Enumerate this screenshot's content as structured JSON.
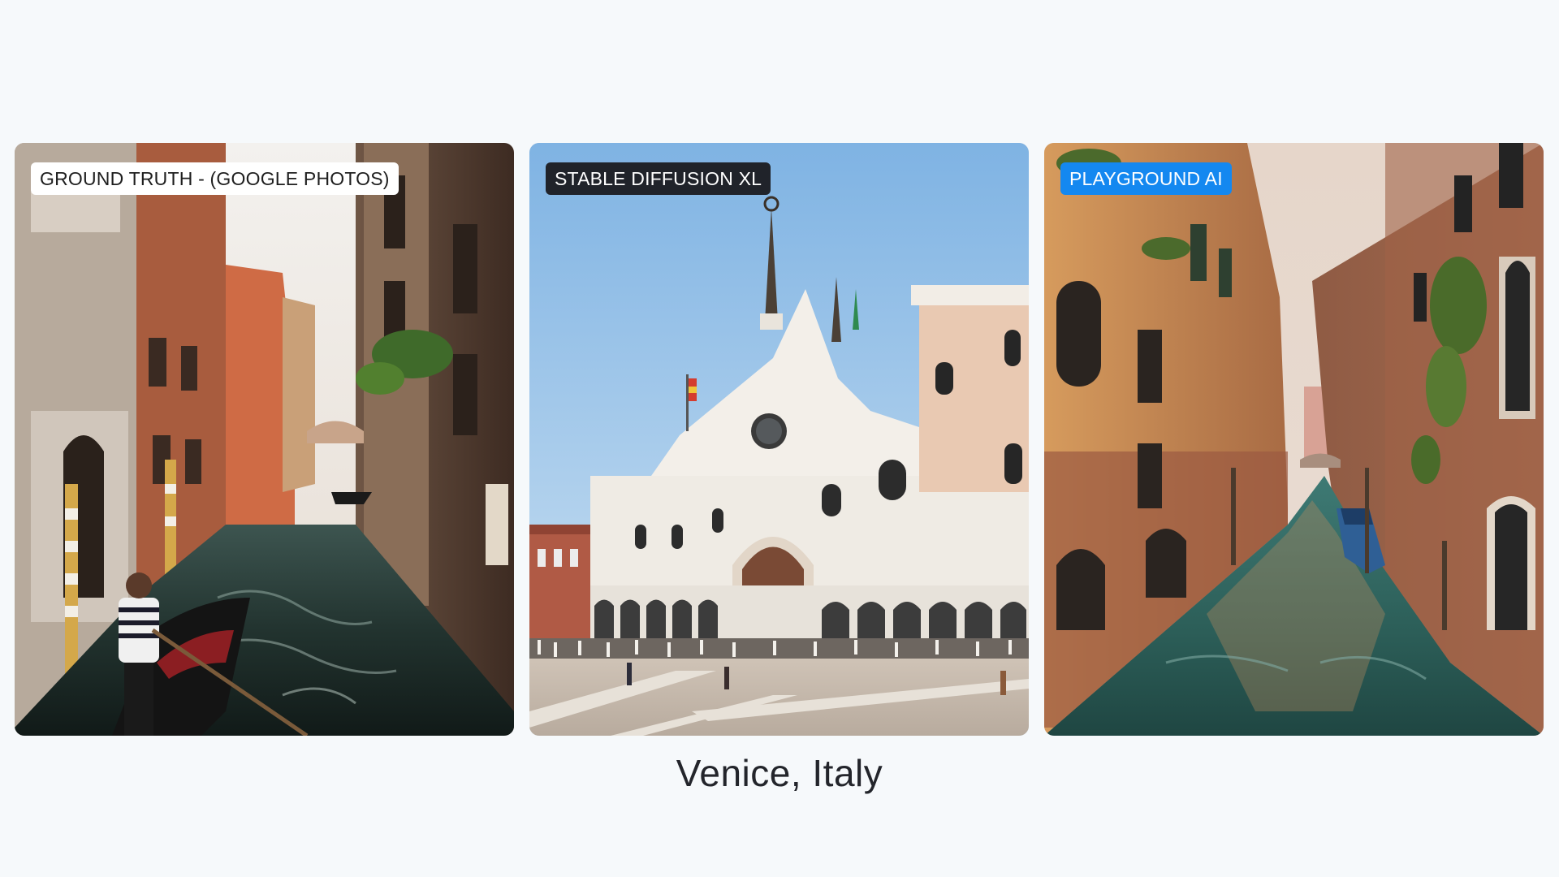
{
  "cards": [
    {
      "label": "GROUND TRUTH - (GOOGLE PHOTOS)",
      "label_style": "light",
      "scene": "venice-canal-gondola-photo"
    },
    {
      "label": "STABLE DIFFUSION XL",
      "label_style": "dark",
      "scene": "piazza-san-marco-render"
    },
    {
      "label": "PLAYGROUND AI",
      "label_style": "blue",
      "scene": "venice-canal-reflection-render"
    }
  ],
  "caption": "Venice, Italy",
  "colors": {
    "background": "#f6f9fb",
    "label_light": "#ffffff",
    "label_dark": "#20232a",
    "label_blue": "#1488f0"
  }
}
